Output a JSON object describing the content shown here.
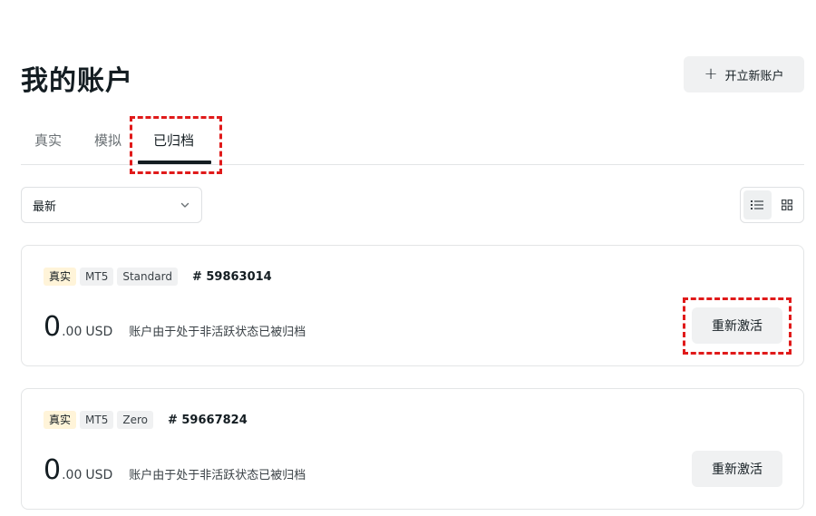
{
  "header": {
    "title": "我的账户",
    "open_account_label": "开立新账户"
  },
  "tabs": [
    {
      "label": "真实",
      "active": false
    },
    {
      "label": "模拟",
      "active": false
    },
    {
      "label": "已归档",
      "active": true
    }
  ],
  "toolbar": {
    "sort_value": "最新",
    "view_mode": "list"
  },
  "accounts": [
    {
      "badges": [
        "真实",
        "MT5",
        "Standard"
      ],
      "account_number": "# 59863014",
      "balance_int": "0",
      "balance_dec": ".00",
      "currency": "USD",
      "note": "账户由于处于非活跃状态已被归档",
      "action_label": "重新激活"
    },
    {
      "badges": [
        "真实",
        "MT5",
        "Zero"
      ],
      "account_number": "# 59667824",
      "balance_int": "0",
      "balance_dec": ".00",
      "currency": "USD",
      "note": "账户由于处于非活跃状态已被归档",
      "action_label": "重新激活"
    }
  ],
  "colors": {
    "highlight": "#e01a1a",
    "real_badge_bg": "#fff4d9",
    "text_primary": "#141d22"
  }
}
